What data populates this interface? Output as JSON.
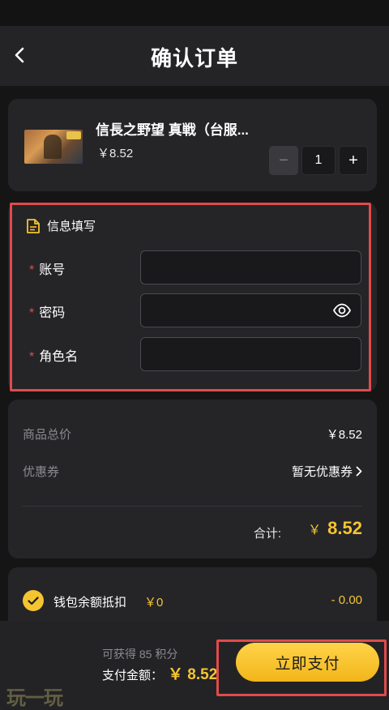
{
  "header": {
    "title": "确认订单"
  },
  "product": {
    "name": "信長之野望 真戦（台服...",
    "price": "￥8.52",
    "quantity": "1",
    "minus_label": "−",
    "plus_label": "+"
  },
  "info_form": {
    "section_title": "信息填写",
    "required_mark": "*",
    "fields": [
      {
        "label": "账号",
        "value": "",
        "placeholder": ""
      },
      {
        "label": "密码",
        "value": "",
        "placeholder": ""
      },
      {
        "label": "角色名",
        "value": "",
        "placeholder": ""
      }
    ]
  },
  "summary": {
    "subtotal_label": "商品总价",
    "subtotal_value": "￥8.52",
    "coupon_label": "优惠券",
    "coupon_value": "暂无优惠券",
    "total_label": "合计:",
    "total_currency": "￥",
    "total_value": "8.52"
  },
  "wallet": {
    "label": "钱包余额抵扣",
    "balance": "￥0",
    "deduction": "- 0.00",
    "checked": true
  },
  "footer": {
    "points_text": "可获得 85 积分",
    "pay_amount_label": "支付金额：",
    "pay_amount_value": "￥ 8.52",
    "pay_button_label": "立即支付"
  },
  "watermark": "玩一玩",
  "colors": {
    "accent": "#f5c431",
    "highlight_border": "#e04b4b",
    "card_bg": "#252528",
    "page_bg": "#151516"
  }
}
